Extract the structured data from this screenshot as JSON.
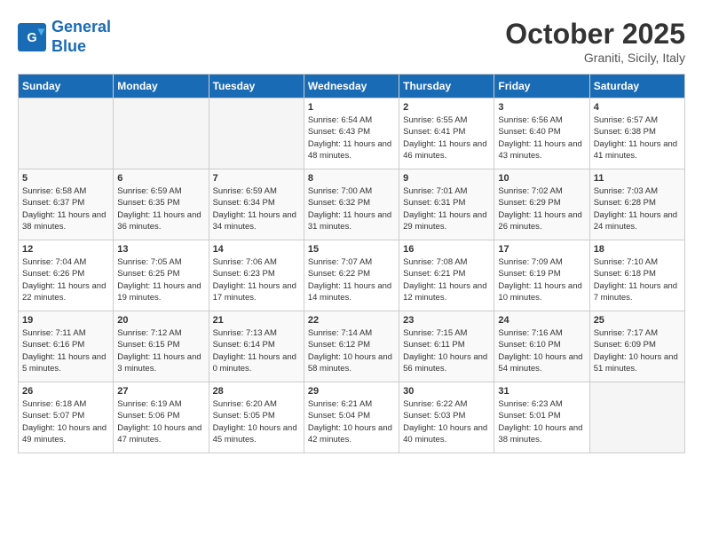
{
  "logo": {
    "line1": "General",
    "line2": "Blue"
  },
  "title": "October 2025",
  "subtitle": "Graniti, Sicily, Italy",
  "days_of_week": [
    "Sunday",
    "Monday",
    "Tuesday",
    "Wednesday",
    "Thursday",
    "Friday",
    "Saturday"
  ],
  "weeks": [
    [
      {
        "day": "",
        "sunrise": "",
        "sunset": "",
        "daylight": ""
      },
      {
        "day": "",
        "sunrise": "",
        "sunset": "",
        "daylight": ""
      },
      {
        "day": "",
        "sunrise": "",
        "sunset": "",
        "daylight": ""
      },
      {
        "day": "1",
        "sunrise": "Sunrise: 6:54 AM",
        "sunset": "Sunset: 6:43 PM",
        "daylight": "Daylight: 11 hours and 48 minutes."
      },
      {
        "day": "2",
        "sunrise": "Sunrise: 6:55 AM",
        "sunset": "Sunset: 6:41 PM",
        "daylight": "Daylight: 11 hours and 46 minutes."
      },
      {
        "day": "3",
        "sunrise": "Sunrise: 6:56 AM",
        "sunset": "Sunset: 6:40 PM",
        "daylight": "Daylight: 11 hours and 43 minutes."
      },
      {
        "day": "4",
        "sunrise": "Sunrise: 6:57 AM",
        "sunset": "Sunset: 6:38 PM",
        "daylight": "Daylight: 11 hours and 41 minutes."
      }
    ],
    [
      {
        "day": "5",
        "sunrise": "Sunrise: 6:58 AM",
        "sunset": "Sunset: 6:37 PM",
        "daylight": "Daylight: 11 hours and 38 minutes."
      },
      {
        "day": "6",
        "sunrise": "Sunrise: 6:59 AM",
        "sunset": "Sunset: 6:35 PM",
        "daylight": "Daylight: 11 hours and 36 minutes."
      },
      {
        "day": "7",
        "sunrise": "Sunrise: 6:59 AM",
        "sunset": "Sunset: 6:34 PM",
        "daylight": "Daylight: 11 hours and 34 minutes."
      },
      {
        "day": "8",
        "sunrise": "Sunrise: 7:00 AM",
        "sunset": "Sunset: 6:32 PM",
        "daylight": "Daylight: 11 hours and 31 minutes."
      },
      {
        "day": "9",
        "sunrise": "Sunrise: 7:01 AM",
        "sunset": "Sunset: 6:31 PM",
        "daylight": "Daylight: 11 hours and 29 minutes."
      },
      {
        "day": "10",
        "sunrise": "Sunrise: 7:02 AM",
        "sunset": "Sunset: 6:29 PM",
        "daylight": "Daylight: 11 hours and 26 minutes."
      },
      {
        "day": "11",
        "sunrise": "Sunrise: 7:03 AM",
        "sunset": "Sunset: 6:28 PM",
        "daylight": "Daylight: 11 hours and 24 minutes."
      }
    ],
    [
      {
        "day": "12",
        "sunrise": "Sunrise: 7:04 AM",
        "sunset": "Sunset: 6:26 PM",
        "daylight": "Daylight: 11 hours and 22 minutes."
      },
      {
        "day": "13",
        "sunrise": "Sunrise: 7:05 AM",
        "sunset": "Sunset: 6:25 PM",
        "daylight": "Daylight: 11 hours and 19 minutes."
      },
      {
        "day": "14",
        "sunrise": "Sunrise: 7:06 AM",
        "sunset": "Sunset: 6:23 PM",
        "daylight": "Daylight: 11 hours and 17 minutes."
      },
      {
        "day": "15",
        "sunrise": "Sunrise: 7:07 AM",
        "sunset": "Sunset: 6:22 PM",
        "daylight": "Daylight: 11 hours and 14 minutes."
      },
      {
        "day": "16",
        "sunrise": "Sunrise: 7:08 AM",
        "sunset": "Sunset: 6:21 PM",
        "daylight": "Daylight: 11 hours and 12 minutes."
      },
      {
        "day": "17",
        "sunrise": "Sunrise: 7:09 AM",
        "sunset": "Sunset: 6:19 PM",
        "daylight": "Daylight: 11 hours and 10 minutes."
      },
      {
        "day": "18",
        "sunrise": "Sunrise: 7:10 AM",
        "sunset": "Sunset: 6:18 PM",
        "daylight": "Daylight: 11 hours and 7 minutes."
      }
    ],
    [
      {
        "day": "19",
        "sunrise": "Sunrise: 7:11 AM",
        "sunset": "Sunset: 6:16 PM",
        "daylight": "Daylight: 11 hours and 5 minutes."
      },
      {
        "day": "20",
        "sunrise": "Sunrise: 7:12 AM",
        "sunset": "Sunset: 6:15 PM",
        "daylight": "Daylight: 11 hours and 3 minutes."
      },
      {
        "day": "21",
        "sunrise": "Sunrise: 7:13 AM",
        "sunset": "Sunset: 6:14 PM",
        "daylight": "Daylight: 11 hours and 0 minutes."
      },
      {
        "day": "22",
        "sunrise": "Sunrise: 7:14 AM",
        "sunset": "Sunset: 6:12 PM",
        "daylight": "Daylight: 10 hours and 58 minutes."
      },
      {
        "day": "23",
        "sunrise": "Sunrise: 7:15 AM",
        "sunset": "Sunset: 6:11 PM",
        "daylight": "Daylight: 10 hours and 56 minutes."
      },
      {
        "day": "24",
        "sunrise": "Sunrise: 7:16 AM",
        "sunset": "Sunset: 6:10 PM",
        "daylight": "Daylight: 10 hours and 54 minutes."
      },
      {
        "day": "25",
        "sunrise": "Sunrise: 7:17 AM",
        "sunset": "Sunset: 6:09 PM",
        "daylight": "Daylight: 10 hours and 51 minutes."
      }
    ],
    [
      {
        "day": "26",
        "sunrise": "Sunrise: 6:18 AM",
        "sunset": "Sunset: 5:07 PM",
        "daylight": "Daylight: 10 hours and 49 minutes."
      },
      {
        "day": "27",
        "sunrise": "Sunrise: 6:19 AM",
        "sunset": "Sunset: 5:06 PM",
        "daylight": "Daylight: 10 hours and 47 minutes."
      },
      {
        "day": "28",
        "sunrise": "Sunrise: 6:20 AM",
        "sunset": "Sunset: 5:05 PM",
        "daylight": "Daylight: 10 hours and 45 minutes."
      },
      {
        "day": "29",
        "sunrise": "Sunrise: 6:21 AM",
        "sunset": "Sunset: 5:04 PM",
        "daylight": "Daylight: 10 hours and 42 minutes."
      },
      {
        "day": "30",
        "sunrise": "Sunrise: 6:22 AM",
        "sunset": "Sunset: 5:03 PM",
        "daylight": "Daylight: 10 hours and 40 minutes."
      },
      {
        "day": "31",
        "sunrise": "Sunrise: 6:23 AM",
        "sunset": "Sunset: 5:01 PM",
        "daylight": "Daylight: 10 hours and 38 minutes."
      },
      {
        "day": "",
        "sunrise": "",
        "sunset": "",
        "daylight": ""
      }
    ]
  ]
}
